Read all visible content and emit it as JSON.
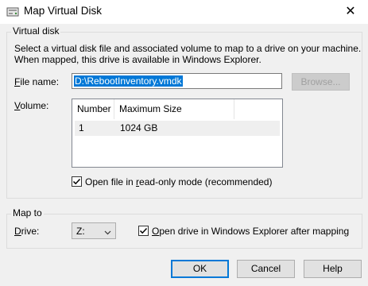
{
  "window": {
    "title": "Map Virtual Disk",
    "close_glyph": "✕"
  },
  "virtual_disk": {
    "group_label": "Virtual disk",
    "description_line1": "Select a virtual disk file and associated volume to map to a drive on your machine.",
    "description_line2": "When mapped, this drive is available in Windows Explorer.",
    "file_name_label_access": "F",
    "file_name_label_rest": "ile name:",
    "file_name_value": "D:\\RebootInventory.vmdk",
    "browse_label": "Browse...",
    "volume_label_access": "V",
    "volume_label_rest": "olume:",
    "volume_table": {
      "headers": [
        "Number",
        "Maximum Size"
      ],
      "rows": [
        {
          "number": "1",
          "size": "1024 GB"
        }
      ]
    },
    "readonly_checked": true,
    "readonly_pre": "Open file in ",
    "readonly_access": "r",
    "readonly_post": "ead-only mode (recommended)"
  },
  "map_to": {
    "group_label": "Map to",
    "drive_label_access": "D",
    "drive_label_rest": "rive:",
    "drive_value": "Z:",
    "open_explorer_checked": true,
    "open_explorer_access": "O",
    "open_explorer_rest": "pen drive in Windows Explorer after mapping"
  },
  "buttons": {
    "ok": "OK",
    "cancel": "Cancel",
    "help": "Help"
  },
  "icons": {
    "title_icon": "map-drive-icon",
    "close": "close-icon",
    "combo_arrow": "chevron-down-icon",
    "check": "checkmark-icon"
  },
  "colors": {
    "selection": "#0078d7",
    "dialog_bg": "#f0f0f0"
  }
}
